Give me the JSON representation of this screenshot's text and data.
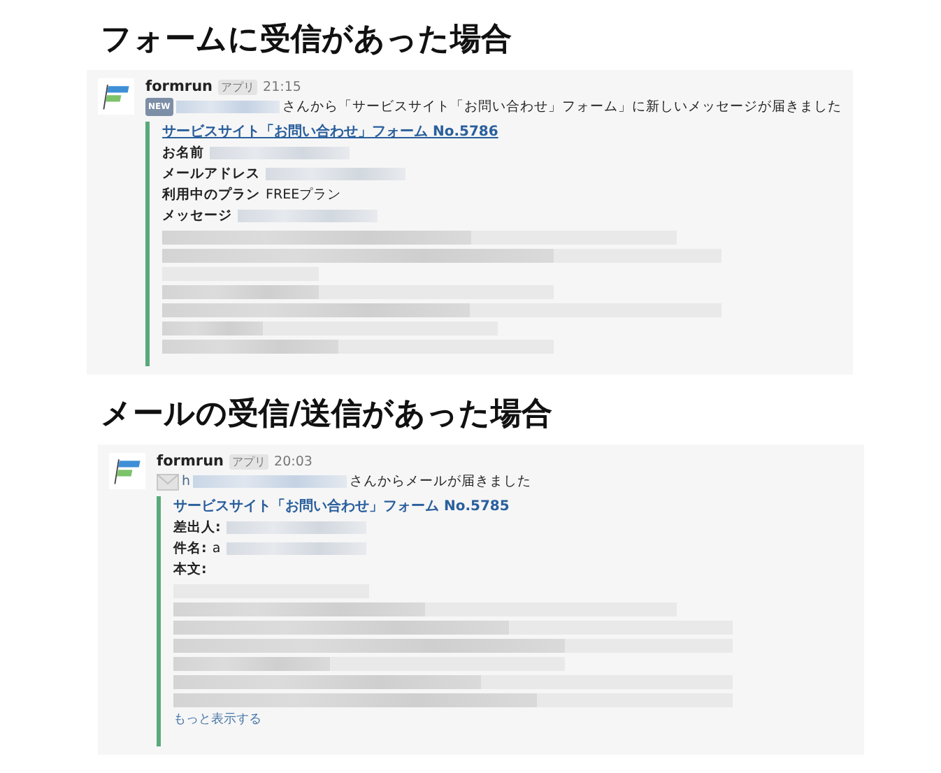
{
  "sections": [
    {
      "heading": "フォームに受信があった場合",
      "message": {
        "sender": "formrun",
        "badge": "アプリ",
        "time": "21:15",
        "prefix": {
          "kind": "new",
          "label": "NEW"
        },
        "intro": "さんから「サービスサイト「お問い合わせ」フォーム」に新しいメッセージが届きました",
        "attachment": {
          "title": "サービスサイト「お問い合わせ」フォーム No.5786",
          "underlined": true,
          "fields": [
            {
              "label": "お名前",
              "blurred": true
            },
            {
              "label": "メールアドレス",
              "blurred": true
            },
            {
              "label": "利用中のプラン",
              "value": "FREEプラン",
              "blurred": false
            },
            {
              "label": "メッセージ",
              "blurred": true
            }
          ]
        }
      }
    },
    {
      "heading": "メールの受信/送信があった場合",
      "message": {
        "sender": "formrun",
        "badge": "アプリ",
        "time": "20:03",
        "prefix": {
          "kind": "mail",
          "label": "h"
        },
        "intro": "さんからメールが届きました",
        "attachment": {
          "title": "サービスサイト「お問い合わせ」フォーム No.5785",
          "underlined": false,
          "fields": [
            {
              "label": "差出人:",
              "blurred": true
            },
            {
              "label": "件名:",
              "value": "a",
              "blurred": true
            },
            {
              "label": "本文:",
              "blurred": false
            }
          ],
          "show_more": "もっと表示する"
        }
      }
    }
  ]
}
